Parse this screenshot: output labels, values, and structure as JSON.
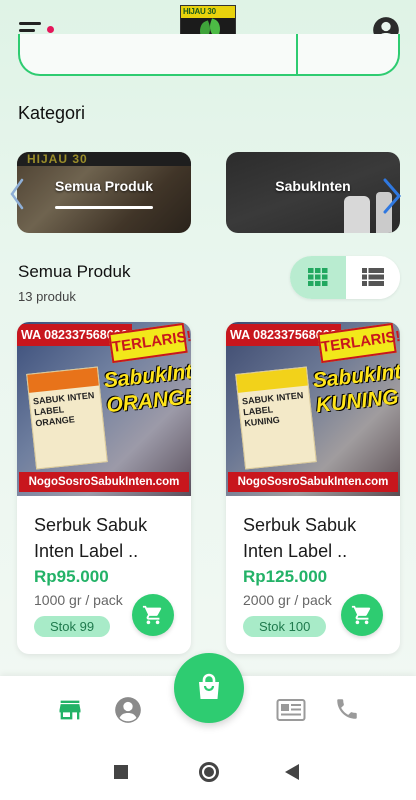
{
  "colors": {
    "accent": "#2ecc71",
    "price": "#23b267",
    "stock_bg": "#a8ebc8",
    "notification_dot": "#e4165a"
  },
  "topbar": {
    "menu_icon": "hamburger-menu-icon",
    "account_icon": "account-circle-icon",
    "logo_text": "HIJAU 30"
  },
  "categories": {
    "title": "Kategori",
    "items": [
      {
        "label": "Semua Produk",
        "selected": true,
        "image_text": "HIJAU 30"
      },
      {
        "label": "SabukInten",
        "selected": false
      }
    ]
  },
  "products_section": {
    "title": "Semua Produk",
    "count": "13 produk",
    "view_mode": "grid"
  },
  "products": [
    {
      "name": "Serbuk Sabuk Inten Label ..",
      "price": "Rp95.000",
      "unit": "1000 gr / pack",
      "stock": "Stok 99",
      "image": {
        "wa": "WA 082337568666",
        "badge": "TERLARIS!",
        "package_text": "SABUK INTEN LABEL ORANGE",
        "brand": "SabukInten ORANGE",
        "site": "NogoSosroSabukInten.com",
        "label_color": "#e8731a"
      }
    },
    {
      "name": "Serbuk Sabuk Inten Label ..",
      "price": "Rp125.000",
      "unit": "2000 gr / pack",
      "stock": "Stok 100",
      "image": {
        "wa": "WA 082337568666",
        "badge": "TERLARIS!",
        "package_text": "SABUK INTEN LABEL KUNING",
        "brand": "SabukInten KUNING",
        "site": "NogoSosroSabukInten.com",
        "label_color": "#f2d21a"
      }
    }
  ],
  "bottom_nav": {
    "items": [
      "store-icon",
      "account-circle-icon",
      "shopping-bag-icon",
      "newspaper-icon",
      "phone-icon"
    ],
    "active": "store-icon"
  }
}
